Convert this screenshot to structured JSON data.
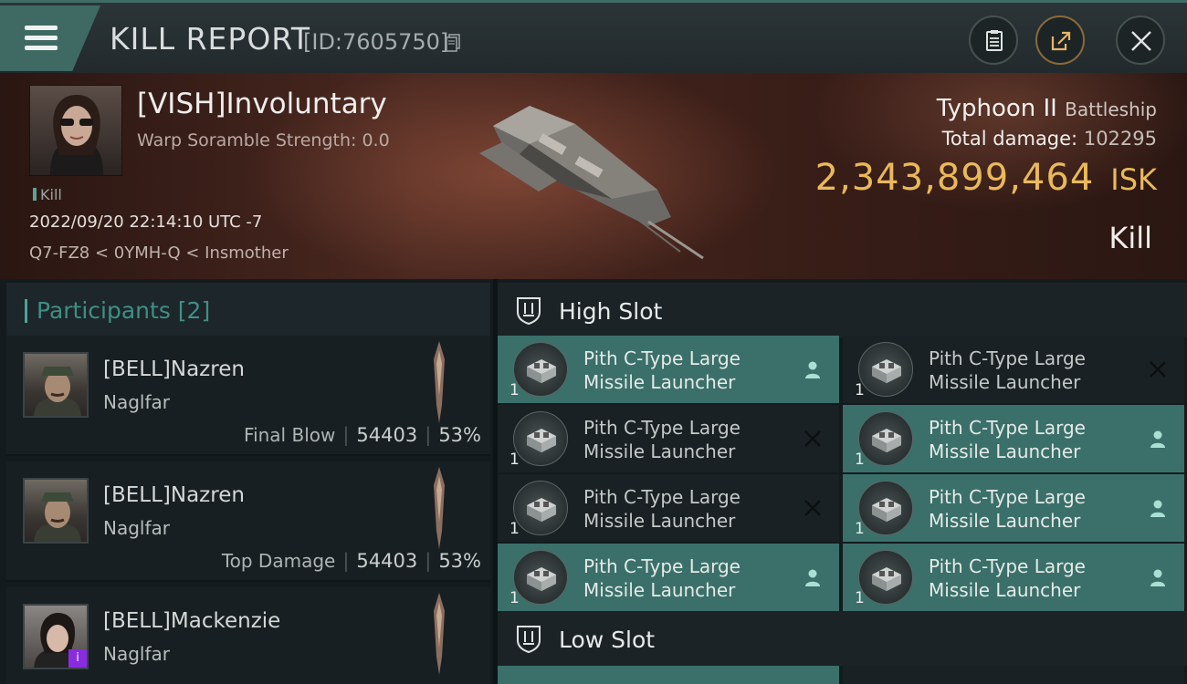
{
  "window": {
    "title": "KILL REPORT",
    "report_id": "[ID:7605750]"
  },
  "victim": {
    "name": "[VISH]Involuntary",
    "warp_scramble": "Warp Soramble Strength: 0.0",
    "tag": "Kill",
    "datetime": "2022/09/20 22:14:10 UTC -7",
    "location": "Q7-FZ8 < 0YMH-Q < Insmother",
    "ship_name": "Typhoon II",
    "ship_class": "Battleship",
    "total_damage_label": "Total damage:",
    "total_damage": "102295",
    "isk_value": "2,343,899,464",
    "isk_unit": "ISK",
    "result": "Kill"
  },
  "participants": {
    "heading": "Participants [2]",
    "rows": [
      {
        "name": "[BELL]Nazren",
        "ship": "Naglfar",
        "role": "Final Blow",
        "damage": "54403",
        "percent": "53%"
      },
      {
        "name": "[BELL]Nazren",
        "ship": "Naglfar",
        "role": "Top Damage",
        "damage": "54403",
        "percent": "53%"
      },
      {
        "name": "[BELL]Mackenzie",
        "ship": "Naglfar",
        "badge": "i"
      }
    ]
  },
  "fitting": {
    "high_slot_label": "High Slot",
    "low_slot_label": "Low Slot",
    "modules": [
      {
        "name": "Pith C-Type Large Missile Launcher",
        "qty": "1",
        "state": "fitted"
      },
      {
        "name": "Pith C-Type Large Missile Launcher",
        "qty": "1",
        "state": "destroyed"
      },
      {
        "name": "Pith C-Type Large Missile Launcher",
        "qty": "1",
        "state": "destroyed"
      },
      {
        "name": "Pith C-Type Large Missile Launcher",
        "qty": "1",
        "state": "fitted"
      },
      {
        "name": "Pith C-Type Large Missile Launcher",
        "qty": "1",
        "state": "destroyed"
      },
      {
        "name": "Pith C-Type Large Missile Launcher",
        "qty": "1",
        "state": "fitted"
      },
      {
        "name": "Pith C-Type Large Missile Launcher",
        "qty": "1",
        "state": "fitted"
      },
      {
        "name": "Pith C-Type Large Missile Launcher",
        "qty": "1",
        "state": "fitted"
      }
    ]
  },
  "icons": {
    "menu": "hamburger-icon",
    "copy": "copy-icon",
    "clipboard": "clipboard-icon",
    "share": "share-icon",
    "close": "close-icon",
    "slot": "slot-icon",
    "pilot": "pilot-icon",
    "destroyed": "x-icon"
  },
  "colors": {
    "accent": "#3e6a63",
    "isk": "#e9b95a",
    "fitted_module": "#3a7069",
    "empty_module": "#1a2124"
  }
}
